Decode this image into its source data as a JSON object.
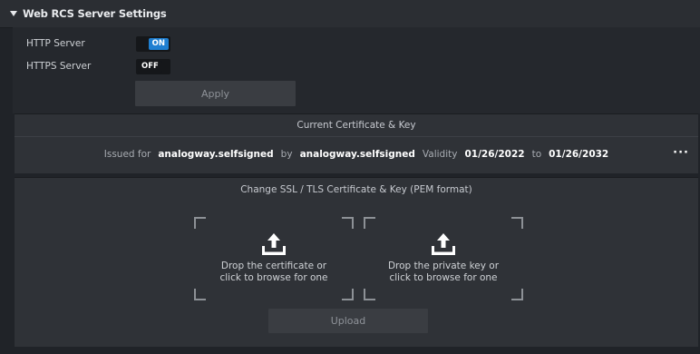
{
  "header": {
    "title": "Web RCS Server Settings",
    "caret_icon": "caret-down-icon"
  },
  "servers": {
    "http": {
      "label": "HTTP Server",
      "state": "ON"
    },
    "https": {
      "label": "HTTPS Server",
      "state": "OFF"
    },
    "apply_label": "Apply"
  },
  "certificate": {
    "title": "Current Certificate & Key",
    "issued_for_label": "Issued for",
    "issued_for": "analogway.selfsigned",
    "by_label": "by",
    "issuer": "analogway.selfsigned",
    "validity_label": "Validity",
    "valid_from": "01/26/2022",
    "to_label": "to",
    "valid_to": "01/26/2032",
    "more_label": "···"
  },
  "upload": {
    "title": "Change SSL / TLS Certificate & Key (PEM format)",
    "cert_drop_line1": "Drop the certificate or",
    "cert_drop_line2": "click to browse for one",
    "key_drop_line1": "Drop the private key or",
    "key_drop_line2": "click to browse for one",
    "upload_label": "Upload"
  },
  "colors": {
    "accent": "#1f7fd1",
    "background": "#202328",
    "panel": "#2f3237"
  }
}
